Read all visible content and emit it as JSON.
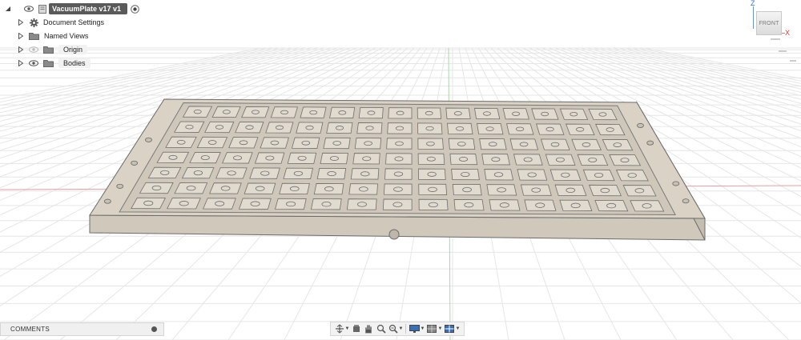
{
  "browser": {
    "document_title": "VacuumPlate v17 v1",
    "items": [
      {
        "label": "Document Settings",
        "icon": "gear-icon"
      },
      {
        "label": "Named Views",
        "icon": "folder-icon"
      },
      {
        "label": "Origin",
        "icon": "folder-icon"
      },
      {
        "label": "Bodies",
        "icon": "folder-icon"
      }
    ]
  },
  "viewcube": {
    "face_label": "FRONT",
    "axis_z": "Z",
    "axis_x": "X"
  },
  "comments_panel": {
    "label": "COMMENTS"
  },
  "navigation_toolbar": {
    "tools": [
      "orbit-icon",
      "look-at-icon",
      "pan-hand-icon",
      "zoom-icon",
      "zoom-window-icon",
      "display-settings-icon",
      "visual-style-icon",
      "grid-icon",
      "viewports-icon"
    ]
  },
  "colors": {
    "model_top": "#d9d2c5",
    "model_front": "#cfc8bb",
    "model_outline": "#6b6b6b",
    "grid_line": "#e6e6e6",
    "axis_red": "#e3a0a0",
    "axis_green": "#a8d8a8",
    "accent_blue": "#3a6fd8"
  },
  "model": {
    "cell_columns": 15,
    "cell_rows": 7
  }
}
